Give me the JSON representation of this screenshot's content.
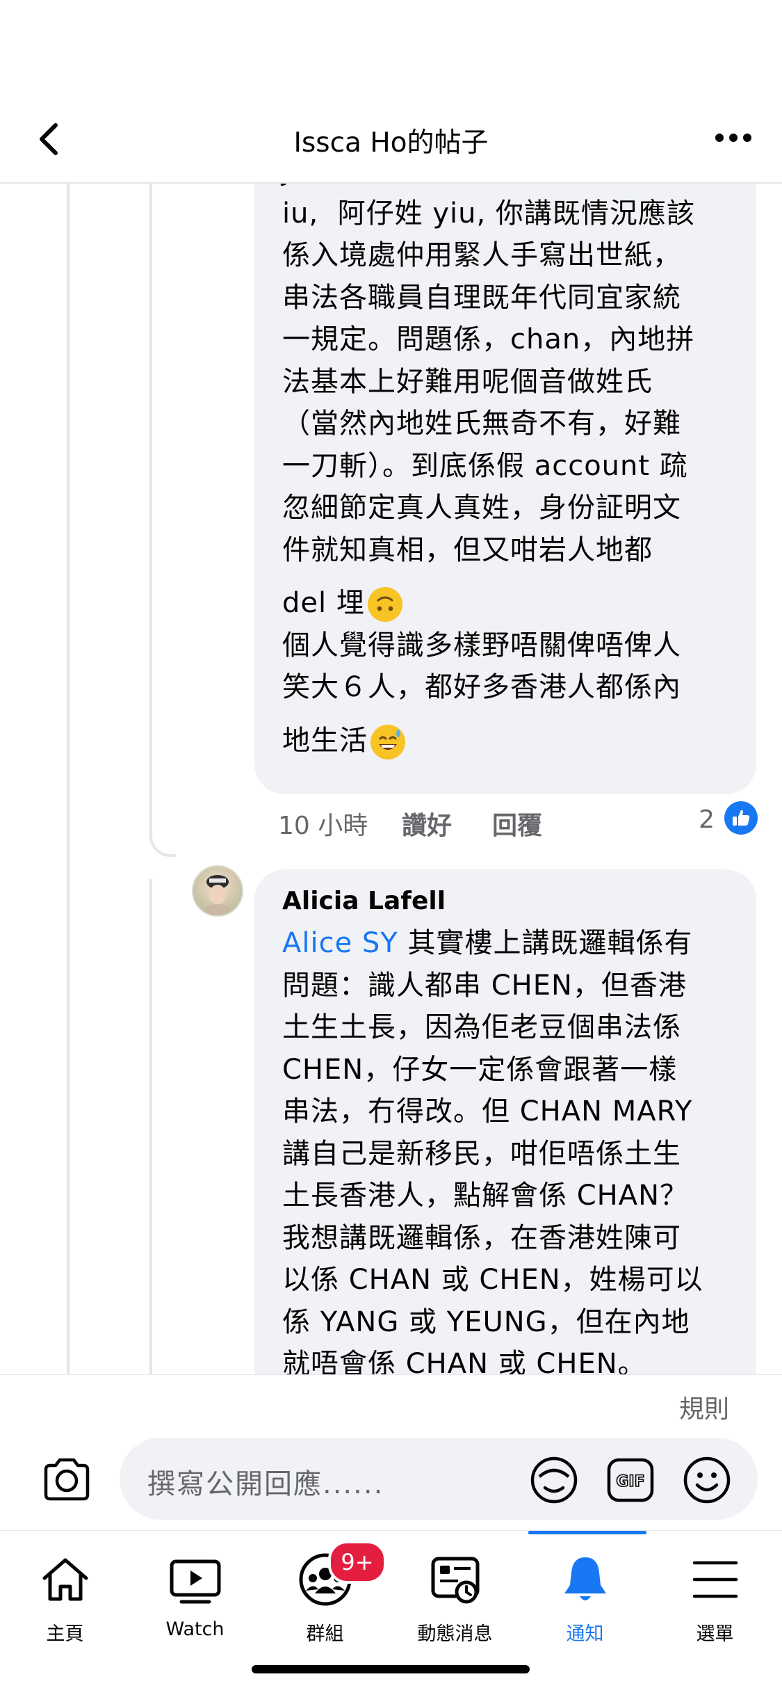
{
  "header": {
    "title": "Issca Ho的帖子"
  },
  "comments": [
    {
      "lines": [
        "Janice Chan 我都有親戚阿爸姓",
        "iu,  阿仔姓 yiu, 你講既情況應該",
        "係入境處仲用緊人手寫出世紙，",
        "串法各職員自理既年代同宜家統",
        "一規定。問題係，chan，內地拼",
        "法基本上好難用呢個音做姓氏",
        "（當然內地姓氏無奇不有，好難",
        "一刀斬）。到底係假 account 疏",
        "忽細節定真人真姓，身份証明文",
        "件就知真相，但又咁岩人地都"
      ],
      "line_emoji_1": "del 埋",
      "lines_b": [
        "個人覺得識多樣野唔關俾唔俾人",
        "笑大６人，都好多香港人都係內"
      ],
      "line_emoji_2": "地生活",
      "time": "10 小時",
      "like_label": "讚好",
      "reply_label": "回覆",
      "reaction_count": "2"
    },
    {
      "author": "Alicia Lafell",
      "mention": "Alice SY",
      "first_line_rest": " 其實樓上講既邏輯係有",
      "lines": [
        "問題：識人都串 CHEN，但香港",
        "土生土長，因為佢老豆個串法係",
        "CHEN，仔女一定係會跟著一樣",
        "串法，冇得改。但 CHAN MARY",
        "講自己是新移民，咁佢唔係土生",
        "土長香港人，點解會係 CHAN？",
        "我想講既邏輯係，在香港姓陳可",
        "以係 CHAN 或 CHEN，姓楊可以",
        "係 YANG 或 YEUNG，但在內地",
        "就唔會係 CHAN 或 CHEN。"
      ]
    }
  ],
  "composer": {
    "rules_label": "規則",
    "placeholder": "撰寫公開回應......",
    "gif_label": "GIF"
  },
  "tabs": [
    {
      "label": "主頁",
      "icon": "home-icon"
    },
    {
      "label": "Watch",
      "icon": "watch-icon"
    },
    {
      "label": "群組",
      "icon": "groups-icon",
      "badge": "9+"
    },
    {
      "label": "動態消息",
      "icon": "news-feed-icon"
    },
    {
      "label": "通知",
      "icon": "bell-icon",
      "active": true
    },
    {
      "label": "選單",
      "icon": "menu-icon"
    }
  ],
  "colors": {
    "accent": "#1877f2",
    "bubble": "#f0f2f5",
    "badge": "#e41e3f",
    "secondary_text": "#65676b"
  }
}
